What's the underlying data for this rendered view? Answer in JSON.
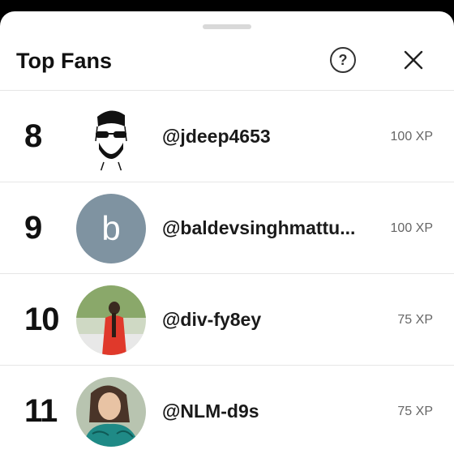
{
  "header": {
    "title": "Top Fans",
    "help_icon": "question-circle-icon",
    "help_glyph": "?",
    "close_icon": "close-icon"
  },
  "fans": [
    {
      "rank": "8",
      "handle": "@jdeep4653",
      "xp": "100 XP",
      "avatar": "sketch-portrait"
    },
    {
      "rank": "9",
      "handle": "@baldevsinghmattu...",
      "xp": "100 XP",
      "avatar_letter": "b",
      "avatar_color": "#7f93a1"
    },
    {
      "rank": "10",
      "handle": "@div-fy8ey",
      "xp": "75 XP",
      "avatar": "photo-red-outfit"
    },
    {
      "rank": "11",
      "handle": "@NLM-d9s",
      "xp": "75 XP",
      "avatar": "photo-teal-outfit"
    }
  ]
}
